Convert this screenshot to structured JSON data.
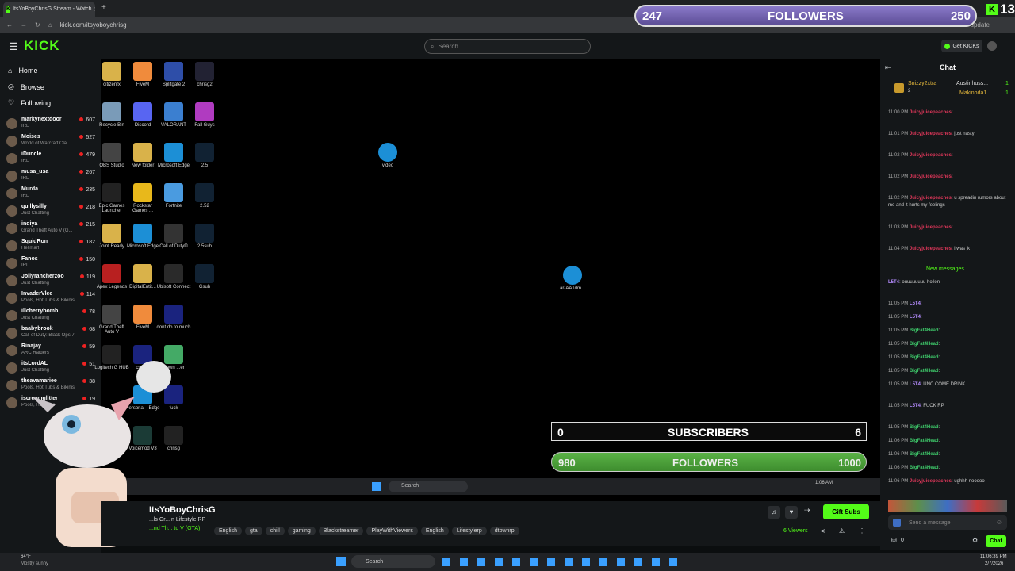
{
  "browser": {
    "tab_title": "ItsYoBoyChrisG Stream - Watch",
    "url": "kick.com/itsyoboychrisg",
    "update_label": "to update"
  },
  "overlay_top": {
    "current": "247",
    "label": "FOLLOWERS",
    "goal": "250",
    "k_count": "13"
  },
  "header": {
    "logo": "KICK",
    "search_placeholder": "Search",
    "get_kicks": "Get KICKs"
  },
  "nav": [
    {
      "label": "Home",
      "icon": "home-icon"
    },
    {
      "label": "Browse",
      "icon": "compass-icon"
    },
    {
      "label": "Following",
      "icon": "heart-icon"
    }
  ],
  "channels": [
    {
      "name": "markynextdoor",
      "category": "IRL",
      "viewers": "607"
    },
    {
      "name": "Moises",
      "category": "World of Warcraft Cla...",
      "viewers": "527"
    },
    {
      "name": "iDuncle",
      "category": "IRL",
      "viewers": "479"
    },
    {
      "name": "musa_usa",
      "category": "IRL",
      "viewers": "267"
    },
    {
      "name": "Murda",
      "category": "IRL",
      "viewers": "235"
    },
    {
      "name": "quillysilly",
      "category": "Just Chatting",
      "viewers": "218"
    },
    {
      "name": "indiya",
      "category": "Grand Theft Auto V (G...",
      "viewers": "215"
    },
    {
      "name": "SquidRon",
      "category": "Hellmart",
      "viewers": "182"
    },
    {
      "name": "Fanos",
      "category": "IRL",
      "viewers": "150"
    },
    {
      "name": "Jollyrancherzoo",
      "category": "Just Chatting",
      "viewers": "119"
    },
    {
      "name": "InvaderVlee",
      "category": "Pools, Hot Tubs & Bikinis",
      "viewers": "114"
    },
    {
      "name": "illcherrybomb",
      "category": "Just Chatting",
      "viewers": "78"
    },
    {
      "name": "baabybrook",
      "category": "Call of Duty: Black Ops 7",
      "viewers": "68"
    },
    {
      "name": "Rinajay",
      "category": "ARC Raiders",
      "viewers": "59"
    },
    {
      "name": "itsLordAL",
      "category": "Just Chatting",
      "viewers": "51"
    },
    {
      "name": "theavamariee",
      "category": "Pools, Hot Tubs & Bikinis",
      "viewers": "38"
    },
    {
      "name": "iscreamglitter",
      "category": "Pools, Hot Tubs",
      "viewers": "19"
    }
  ],
  "desktop_icons": [
    {
      "label": "citizenfx",
      "color": "#d9b24a"
    },
    {
      "label": "FiveM",
      "color": "#f08b3c"
    },
    {
      "label": "Splitgate 2",
      "color": "#2e4ea8"
    },
    {
      "label": "chrisg2",
      "color": "#223"
    },
    {
      "label": "Recycle Bin",
      "color": "#7a9bb8"
    },
    {
      "label": "Discord",
      "color": "#5865f2"
    },
    {
      "label": "VALORANT",
      "color": "#3b7fd0"
    },
    {
      "label": "Fall Guys",
      "color": "#b03bc0"
    },
    {
      "label": "OBS Studio",
      "color": "#444"
    },
    {
      "label": "New folder",
      "color": "#d9b24a"
    },
    {
      "label": "Microsoft Edge",
      "color": "#1c8fd6"
    },
    {
      "label": "2.5",
      "color": "#123"
    },
    {
      "label": "Epic Games Launcher",
      "color": "#222"
    },
    {
      "label": "Rockstar Games ...",
      "color": "#e8b81b"
    },
    {
      "label": "Fortnite",
      "color": "#4a9be0"
    },
    {
      "label": "2.52",
      "color": "#123"
    },
    {
      "label": "Joint Ready",
      "color": "#d9b24a"
    },
    {
      "label": "Microsoft Edge",
      "color": "#1c8fd6"
    },
    {
      "label": "Call of Duty®",
      "color": "#333"
    },
    {
      "label": "2.5sub",
      "color": "#123"
    },
    {
      "label": "Apex Legends",
      "color": "#b82020"
    },
    {
      "label": "DigitalEntit...",
      "color": "#d9b24a"
    },
    {
      "label": "Ubisoft Connect",
      "color": "#2a2a2a"
    },
    {
      "label": "Gsub",
      "color": "#123"
    },
    {
      "label": "Grand Theft Auto V",
      "color": "#444"
    },
    {
      "label": "FiveM",
      "color": "#f08b3c"
    },
    {
      "label": "dont do to much",
      "color": "#1a237e"
    },
    {
      "label": "",
      "color": "#000"
    },
    {
      "label": "Logitech G HUB",
      "color": "#222"
    },
    {
      "label": "csdc...",
      "color": "#1a237e"
    },
    {
      "label": "Down ...er",
      "color": "#4a6"
    },
    {
      "label": "",
      "color": "#000"
    },
    {
      "label": "",
      "color": "#000"
    },
    {
      "label": "Personal - Edge",
      "color": "#1c8fd6"
    },
    {
      "label": "fuck",
      "color": "#1a237e"
    },
    {
      "label": "",
      "color": "#000"
    },
    {
      "label": "",
      "color": "#000"
    },
    {
      "label": "Voicemod V3",
      "color": "#1b3b36"
    },
    {
      "label": "chrisg",
      "color": "#222"
    }
  ],
  "floating_icons": [
    {
      "label": "video"
    },
    {
      "label": "ar-AA1dm..."
    }
  ],
  "overlay": {
    "sub_current": "0",
    "sub_label": "SUBSCRIBERS",
    "sub_goal": "6",
    "fol_current": "980",
    "fol_label": "FOLLOWERS",
    "fol_goal": "1000"
  },
  "inner_taskbar": {
    "search": "Search",
    "time": "1:06 AM"
  },
  "stream": {
    "channel": "ItsYoBoyChrisG",
    "title": "...ls Gr... n Lifestyle RP",
    "category": "...nd Th... to V (GTA)",
    "tags": [
      "English",
      "gta",
      "chill",
      "gaming",
      "Blackstreamer",
      "PlayWithViewers",
      "English",
      "Lifestylerp",
      "dtownrp"
    ],
    "gift_subs": "Gift Subs",
    "viewers": "6 Viewers"
  },
  "chat": {
    "header": "Chat",
    "top_gifters": [
      {
        "name": "Snizzy2xtra",
        "count": "2"
      },
      {
        "name": "Austinhuss...",
        "count": "1"
      },
      {
        "name": "Makinoda1",
        "count": "1"
      }
    ],
    "messages": [
      {
        "time": "11:00 PM",
        "user": "Juicyjuicepeaches",
        "text": "",
        "color": "#e0375a"
      },
      {
        "time": "11:01 PM",
        "user": "Juicyjuicepeaches",
        "text": "just nasty",
        "color": "#e0375a"
      },
      {
        "time": "11:02 PM",
        "user": "Juicyjuicepeaches",
        "text": "",
        "color": "#e0375a"
      },
      {
        "time": "11:02 PM",
        "user": "Juicyjuicepeaches",
        "text": "",
        "color": "#e0375a"
      },
      {
        "time": "11:02 PM",
        "user": "Juicyjuicepeaches",
        "text": "u spreadin rumors about me and it hurts my feelings",
        "color": "#e0375a"
      },
      {
        "time": "11:03 PM",
        "user": "Juicyjuicepeaches",
        "text": "",
        "color": "#e0375a"
      },
      {
        "time": "11:04 PM",
        "user": "Juicyjuicepeaches",
        "text": "i was jk",
        "color": "#e0375a"
      }
    ],
    "new_messages": "New messages",
    "messages2": [
      {
        "time": "",
        "user": "L5T4",
        "text": "ouuuuuuuu hollon",
        "color": "#b58cff"
      },
      {
        "time": "11:05 PM",
        "user": "L5T4",
        "text": "",
        "color": "#b58cff"
      },
      {
        "time": "11:05 PM",
        "user": "L5T4",
        "text": "",
        "color": "#b58cff"
      },
      {
        "time": "11:05 PM",
        "user": "BigFat4Head",
        "text": "",
        "color": "#3ec96a"
      },
      {
        "time": "11:05 PM",
        "user": "BigFat4Head",
        "text": "",
        "color": "#3ec96a"
      },
      {
        "time": "11:05 PM",
        "user": "BigFat4Head",
        "text": "",
        "color": "#3ec96a"
      },
      {
        "time": "11:05 PM",
        "user": "BigFat4Head",
        "text": "",
        "color": "#3ec96a"
      },
      {
        "time": "11:05 PM",
        "user": "L5T4",
        "text": "UNC COME DRINK",
        "color": "#b58cff"
      },
      {
        "time": "11:05 PM",
        "user": "L5T4",
        "text": "FUCK RP",
        "color": "#b58cff"
      },
      {
        "time": "11:05 PM",
        "user": "BigFat4Head",
        "text": "",
        "color": "#3ec96a"
      },
      {
        "time": "11:06 PM",
        "user": "BigFat4Head",
        "text": "",
        "color": "#3ec96a"
      },
      {
        "time": "11:06 PM",
        "user": "BigFat4Head",
        "text": "",
        "color": "#3ec96a"
      },
      {
        "time": "11:06 PM",
        "user": "BigFat4Head",
        "text": "",
        "color": "#3ec96a"
      },
      {
        "time": "11:06 PM",
        "user": "Juicyjuicepeaches",
        "text": "ughhh nooooo",
        "color": "#e0375a"
      }
    ],
    "input_placeholder": "Send a message",
    "send_label": "Chat",
    "points": "0"
  },
  "win_taskbar": {
    "search": "Search",
    "weather_temp": "64°F",
    "weather_desc": "Mostly sunny",
    "time": "11:06:39 PM",
    "date": "2/7/2026"
  },
  "colors": {
    "kick_green": "#53fc18",
    "bg": "#0b0e0f"
  }
}
